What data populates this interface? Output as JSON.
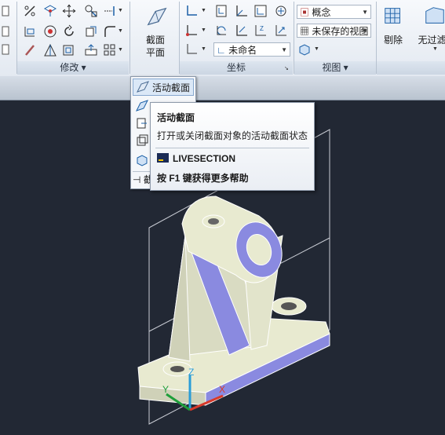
{
  "panels": {
    "modify": {
      "title": "修改"
    },
    "section": {
      "button_line1": "截面",
      "button_line2": "平面"
    },
    "coordinates": {
      "title": "坐标",
      "ucs_name": "未命名"
    },
    "view": {
      "title": "视图",
      "visual_style": "概念",
      "saved_view": "未保存的视图"
    },
    "delete": {
      "label": "剔除"
    },
    "filter": {
      "label": "无过滤"
    }
  },
  "dropdown": {
    "items": [
      {
        "label": "活动截面",
        "icon": "live-section-icon"
      },
      {
        "label": "",
        "icon": "add-jog-icon"
      },
      {
        "label": "",
        "icon": "generate-section-icon"
      },
      {
        "label": "",
        "icon": "section-plane-settings-icon"
      },
      {
        "label": "",
        "icon": "section-box-icon"
      }
    ],
    "footer_label": "截"
  },
  "tooltip": {
    "title": "活动截面",
    "description": "打开或关闭截面对象的活动截面状态",
    "command": "LIVESECTION",
    "help": "按 F1 键获得更多帮助"
  },
  "ucs_labels": {
    "z": "Z",
    "y": "Y",
    "x": "X"
  },
  "colors": {
    "viewport_bg": "#222834",
    "model_face": "#e8ead0",
    "model_shade": "#8888dd",
    "ucs_z": "#2a9dd8",
    "ucs_y": "#1e9e3a",
    "ucs_x": "#d83a2a"
  }
}
